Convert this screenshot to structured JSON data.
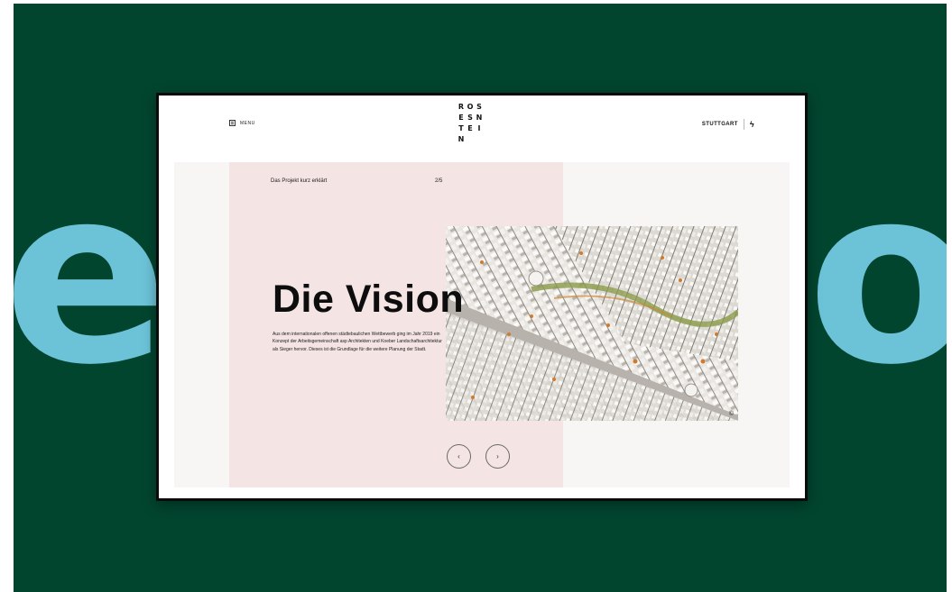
{
  "background": {
    "word_left": "ie",
    "word_right": "or",
    "colors": {
      "stage": "#02452f",
      "word": "#6cc3d8"
    }
  },
  "header": {
    "menu_label": "MENU",
    "menu_icon": "menu-icon",
    "logo_letters": [
      "R",
      "O",
      "S",
      "E",
      "S",
      "",
      "N",
      "T",
      "E",
      "I",
      "N"
    ],
    "city_label": "STUTTGART",
    "city_emblem": "ϟ",
    "city_icon": "stuttgart-emblem-icon"
  },
  "slide": {
    "kicker": "Das Projekt kurz erklärt",
    "counter": "2/5",
    "title": "Die Vision",
    "description": "Aus dem internationalen offenen städtebaulichen Wettbewerb ging im Jahr 2019 ein Konzept der Arbeitsgemeinschaft asp Architekten und Koeber Landschaftsarchitektur als Sieger hervor. Dieses ist die Grundlage für die weitere Planung der Stadt.",
    "photo_corner": "©",
    "photo_subject": "city-model-photo",
    "colors": {
      "pink_panel": "#f4e4e4",
      "content_bg": "#f8f5f5"
    }
  },
  "controls": {
    "prev_symbol": "‹",
    "next_symbol": "›",
    "prev_icon": "arrow-left-icon",
    "next_icon": "arrow-right-icon"
  }
}
